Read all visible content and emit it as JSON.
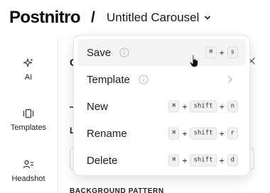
{
  "header": {
    "logo": "Postnitro",
    "separator": "/",
    "carousel_title": "Untitled Carousel",
    "title_icon": "chevron-down-icon"
  },
  "sidebar": {
    "items": [
      {
        "label": "AI",
        "icon": "sparkles-icon"
      },
      {
        "label": "Templates",
        "icon": "templates-icon"
      },
      {
        "label": "Headshot",
        "icon": "headshot-icon"
      }
    ]
  },
  "panel": {
    "heading_fragment": "C",
    "label_fragment": "L",
    "section_fragment": "BACKGROUND PATTERN"
  },
  "menu": {
    "items": [
      {
        "label": "Save",
        "info_icon": true,
        "keys": [
          "⌘",
          "s"
        ]
      },
      {
        "label": "Template",
        "info_icon": true,
        "submenu": true
      },
      {
        "label": "New",
        "keys": [
          "⌘",
          "shift",
          "n"
        ]
      },
      {
        "label": "Rename",
        "keys": [
          "⌘",
          "shift",
          "r"
        ]
      },
      {
        "label": "Delete",
        "keys": [
          "⌘",
          "shift",
          "d"
        ]
      }
    ],
    "plus": "+"
  },
  "colors": {
    "accent": "#1f7a55",
    "hover_bg": "#f3f4f6",
    "kbd_bg": "#f1f1f1"
  }
}
